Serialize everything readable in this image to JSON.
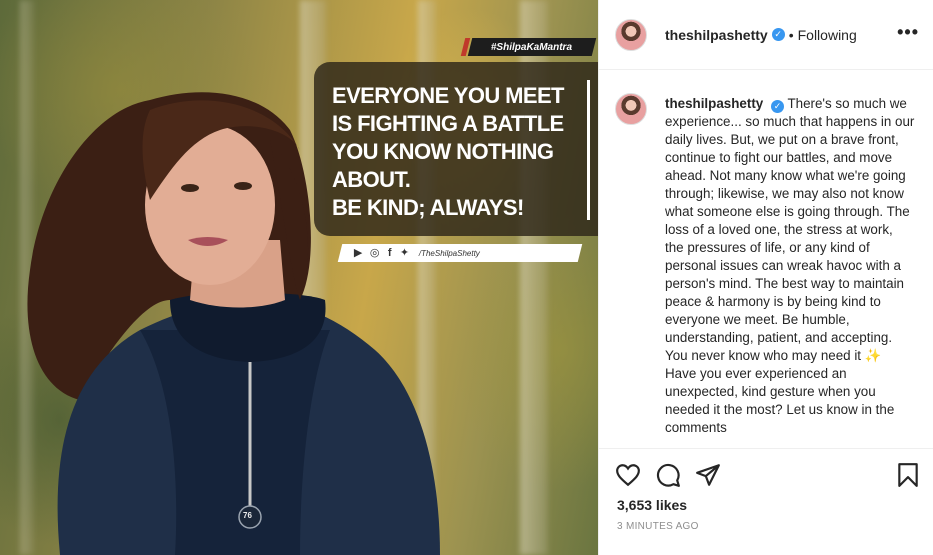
{
  "post_image": {
    "hashtag": "#ShilpaKaMantra",
    "quote_lines": [
      "EVERYONE YOU MEET",
      "IS FIGHTING A BATTLE",
      "YOU KNOW NOTHING ABOUT.",
      "BE KIND; ALWAYS!"
    ],
    "social_handle": "/TheShilpaShetty",
    "social_icons": [
      "youtube-icon",
      "instagram-icon",
      "facebook-icon",
      "twitter-icon"
    ],
    "jacket_tag": "76"
  },
  "header": {
    "username": "theshilpashetty",
    "separator": "•",
    "follow_status": "Following",
    "more_label": "•••"
  },
  "caption": {
    "username": "theshilpashetty",
    "text": "There's so much we experience... so much that happens in our daily lives. But, we put on a brave front, continue to fight our battles, and move ahead. Not many know what we're going through; likewise, we may also not know what someone else is going through. The loss of a loved one, the stress at work, the pressures of life, or any kind of personal issues can wreak havoc with a person's mind. The best way to maintain peace & harmony is by being kind to everyone we meet. Be humble, understanding, patient, and accepting. You never know who may need it ✨ Have you ever experienced an unexpected, kind gesture when you needed it the most? Let us know in the comments"
  },
  "engagement": {
    "likes": "3,653 likes",
    "timestamp": "3 MINUTES AGO"
  },
  "colors": {
    "verified": "#3897f0",
    "text": "#262626",
    "muted": "#8e8e8e"
  }
}
